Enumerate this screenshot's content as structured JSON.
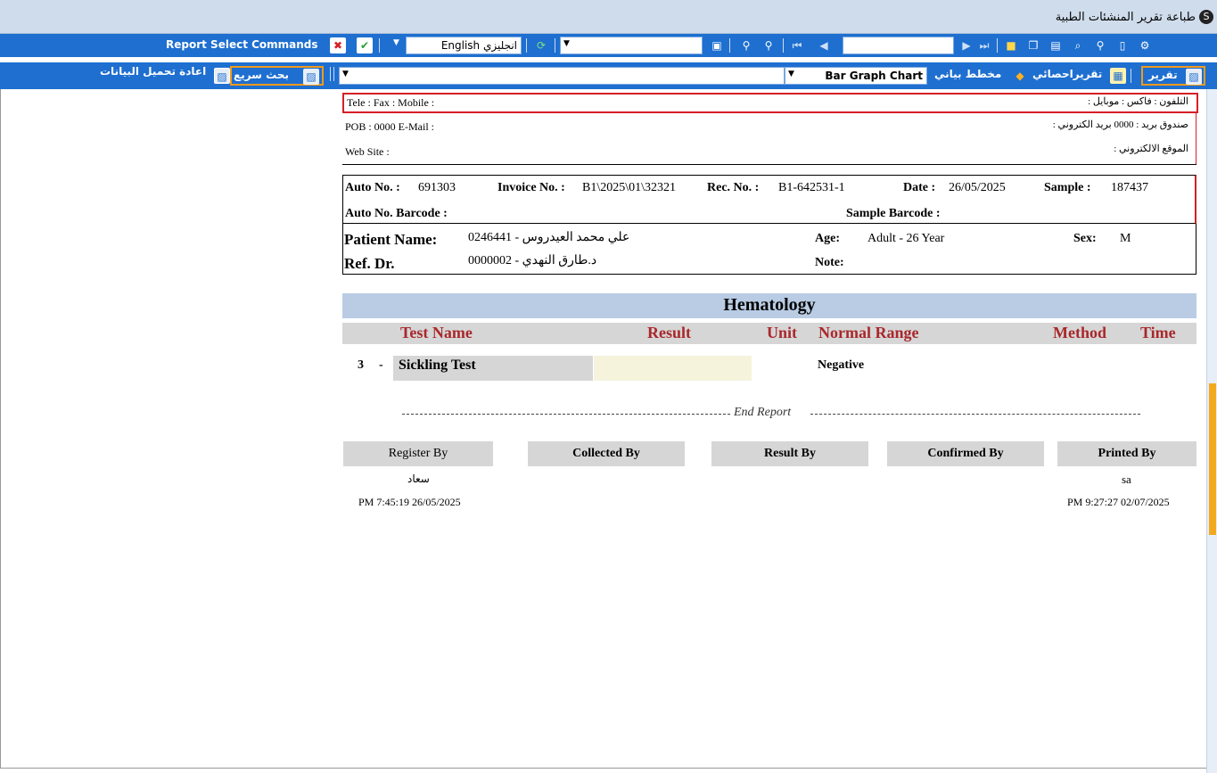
{
  "window": {
    "title": "طباعة تقرير المنشئات الطبية"
  },
  "toolbar1": {
    "report_select_commands": "Report Select Commands",
    "language_value": "English انجليزي",
    "search_value": ""
  },
  "toolbar2": {
    "report_tab": "تقرير",
    "stats_tab": "تقريراحصائي",
    "chart_tab": "مخطط بياني",
    "chart_type_value": "Bar Graph Chart",
    "quick_search": "بحث سريع",
    "reload_data": "اعادة تحميل البيانات"
  },
  "header": {
    "tele_en": "Tele :  Fax :  Mobile :",
    "tele_ar": "التلفون :  فاكس :  موبايل :",
    "pob_en": "POB : 0000  E-Mail :",
    "pob_ar": "صندوق بريد : 0000  بريد الكتروني :",
    "web_en": "Web Site :",
    "web_ar": "الموقع الالكتروني :"
  },
  "invoice": {
    "auto_no_label": "Auto No. :",
    "auto_no": "691303",
    "invoice_no_label": "Invoice No. :",
    "invoice_no": "B1\\2025\\01\\32321",
    "rec_no_label": "Rec. No. :",
    "rec_no": "B1-642531-1",
    "date_label": "Date :",
    "date": "26/05/2025",
    "sample_label": "Sample :",
    "sample": "187437",
    "auto_barcode_label": "Auto No. Barcode :",
    "sample_barcode_label": "Sample Barcode :"
  },
  "patient": {
    "name_label": "Patient Name:",
    "name": "علي محمد العيدروس - 0246441",
    "age_label": "Age:",
    "age": "Adult - 26 Year",
    "sex_label": "Sex:",
    "sex": "M",
    "ref_label": "Ref. Dr.",
    "ref": "د.طارق النهدي - 0000002",
    "note_label": "Note:"
  },
  "section": {
    "title": "Hematology",
    "columns": [
      "Test Name",
      "Result",
      "Unit",
      "Normal Range",
      "Method",
      "Time"
    ]
  },
  "tests": [
    {
      "num": "3",
      "dash": "-",
      "name": "Sickling Test",
      "result": "",
      "unit": "",
      "range": "Negative"
    }
  ],
  "end_report": "End Report",
  "signatures": {
    "register_label": "Register By",
    "collected_label": "Collected By",
    "result_label": "Result By",
    "confirmed_label": "Confirmed By",
    "printed_label": "Printed By",
    "register_name": "سعاد",
    "printed_name": "sa",
    "register_time": "PM 7:45:19 26/05/2025",
    "printed_time": "PM 9:27:27 02/07/2025"
  }
}
